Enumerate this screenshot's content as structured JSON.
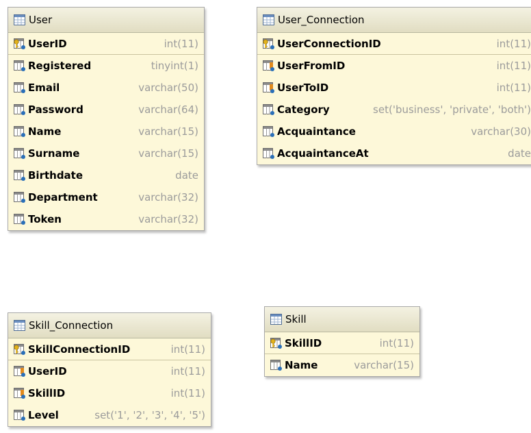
{
  "tables": [
    {
      "title": "User",
      "columns": [
        {
          "name": "UserID",
          "type": "int(11)",
          "icon": "primary-key-icon"
        },
        {
          "name": "Registered",
          "type": "tinyint(1)",
          "icon": "column-icon"
        },
        {
          "name": "Email",
          "type": "varchar(50)",
          "icon": "column-icon"
        },
        {
          "name": "Password",
          "type": "varchar(64)",
          "icon": "column-icon"
        },
        {
          "name": "Name",
          "type": "varchar(15)",
          "icon": "column-icon"
        },
        {
          "name": "Surname",
          "type": "varchar(15)",
          "icon": "column-icon"
        },
        {
          "name": "Birthdate",
          "type": "date",
          "icon": "column-icon"
        },
        {
          "name": "Department",
          "type": "varchar(32)",
          "icon": "column-icon"
        },
        {
          "name": "Token",
          "type": "varchar(32)",
          "icon": "column-icon"
        }
      ]
    },
    {
      "title": "User_Connection",
      "columns": [
        {
          "name": "UserConnectionID",
          "type": "int(11)",
          "icon": "primary-key-icon"
        },
        {
          "name": "UserFromID",
          "type": "int(11)",
          "icon": "foreign-key-icon"
        },
        {
          "name": "UserToID",
          "type": "int(11)",
          "icon": "foreign-key-icon"
        },
        {
          "name": "Category",
          "type": "set('business', 'private', 'both')",
          "icon": "column-icon"
        },
        {
          "name": "Acquaintance",
          "type": "varchar(30)",
          "icon": "column-icon"
        },
        {
          "name": "AcquaintanceAt",
          "type": "date",
          "icon": "column-icon"
        }
      ]
    },
    {
      "title": "Skill_Connection",
      "columns": [
        {
          "name": "SkillConnectionID",
          "type": "int(11)",
          "icon": "primary-key-icon"
        },
        {
          "name": "UserID",
          "type": "int(11)",
          "icon": "foreign-key-icon"
        },
        {
          "name": "SkillID",
          "type": "int(11)",
          "icon": "foreign-key-icon"
        },
        {
          "name": "Level",
          "type": "set('1', '2', '3', '4', '5')",
          "icon": "column-icon"
        }
      ]
    },
    {
      "title": "Skill",
      "columns": [
        {
          "name": "SkillID",
          "type": "int(11)",
          "icon": "primary-key-icon"
        },
        {
          "name": "Name",
          "type": "varchar(15)",
          "icon": "column-icon"
        }
      ]
    }
  ],
  "colors": {
    "table_body": "#fdf8d9",
    "header": "#e6e2c8",
    "type_text": "#9b9b9b"
  }
}
